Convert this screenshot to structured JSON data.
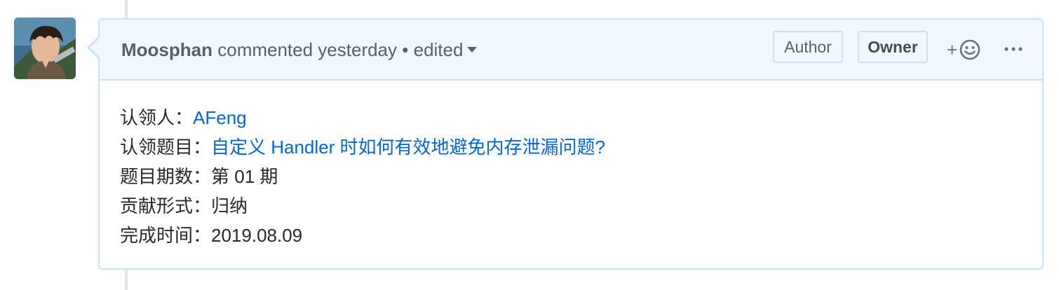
{
  "comment": {
    "author": "Moosphan",
    "action": "commented yesterday",
    "separator": "•",
    "edited": "edited",
    "badges": {
      "author": "Author",
      "owner": "Owner"
    },
    "reaction_plus": "+",
    "rows": [
      {
        "label": "认领人：",
        "value": "AFeng",
        "is_link": true
      },
      {
        "label": "认领题目：",
        "value": "自定义 Handler 时如何有效地避免内存泄漏问题?",
        "is_link": true
      },
      {
        "label": "题目期数：",
        "value": "第 01 期",
        "is_link": false
      },
      {
        "label": "贡献形式：",
        "value": "归纳",
        "is_link": false
      },
      {
        "label": "完成时间：",
        "value": "2019.08.09",
        "is_link": false
      }
    ]
  },
  "colors": {
    "header_bg": "#f1f8ff",
    "border": "#c8e1ff",
    "link": "#0366d6",
    "text": "#24292e",
    "muted": "#586069"
  }
}
